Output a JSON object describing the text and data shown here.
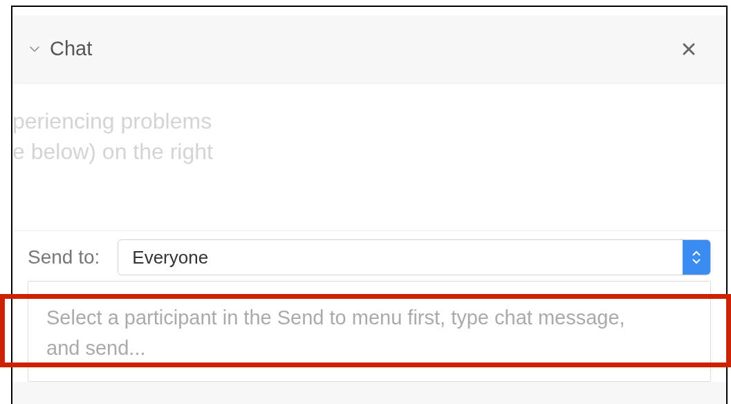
{
  "panel": {
    "title": "Chat",
    "expanded": true
  },
  "background_text": [
    "periencing problems",
    "e below) on the right"
  ],
  "send_to": {
    "label": "Send to:",
    "value": "Everyone"
  },
  "message_field": {
    "placeholder": "Select a participant in the Send to menu first, type chat message, and send..."
  },
  "highlight": {
    "shown": true
  }
}
